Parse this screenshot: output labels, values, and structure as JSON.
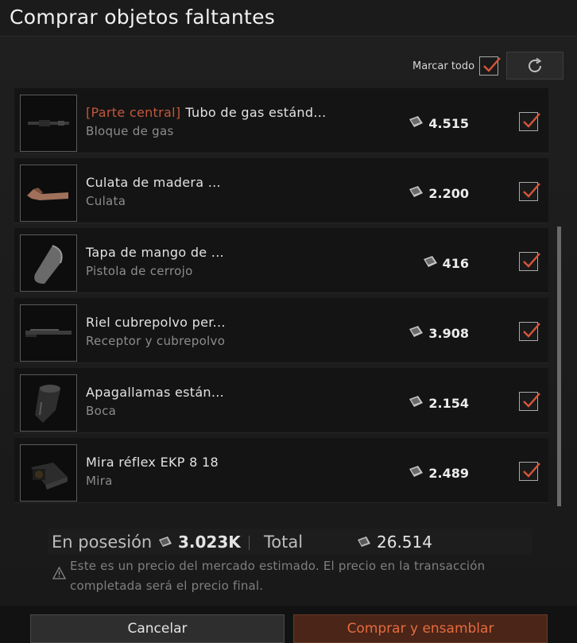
{
  "title": "Comprar objetos faltantes",
  "toolbar": {
    "mark_all_label": "Marcar todo",
    "mark_all_checked": true
  },
  "items": [
    {
      "prefix": "[Parte central]",
      "name": "Tubo de gas estánd...",
      "category": "Bloque de gas",
      "price": "4.515",
      "checked": true,
      "icon": "gas-tube-icon"
    },
    {
      "prefix": "",
      "name": "Culata de madera ...",
      "category": "Culata",
      "price": "2.200",
      "checked": true,
      "icon": "wooden-stock-icon"
    },
    {
      "prefix": "",
      "name": "Tapa de mango de ...",
      "category": "Pistola de cerrojo",
      "price": "416",
      "checked": true,
      "icon": "grip-cap-icon"
    },
    {
      "prefix": "",
      "name": "Riel cubrepolvo per...",
      "category": "Receptor y cubrepolvo",
      "price": "3.908",
      "checked": true,
      "icon": "dust-cover-rail-icon"
    },
    {
      "prefix": "",
      "name": "Apagallamas están...",
      "category": "Boca",
      "price": "2.154",
      "checked": true,
      "icon": "flash-hider-icon"
    },
    {
      "prefix": "",
      "name": "Mira réflex EKP 8 18",
      "category": "Mira",
      "price": "2.489",
      "checked": true,
      "icon": "reflex-sight-icon"
    }
  ],
  "summary": {
    "owned_label": "En posesión",
    "owned_value": "3.023K",
    "total_label": "Total",
    "total_value": "26.514"
  },
  "notice": "Este es un precio del mercado estimado. El precio en la transacción completada será el precio final.",
  "buttons": {
    "cancel": "Cancelar",
    "buy": "Comprar y ensamblar"
  },
  "colors": {
    "accent": "#e66b3e",
    "check": "#d9553a"
  }
}
